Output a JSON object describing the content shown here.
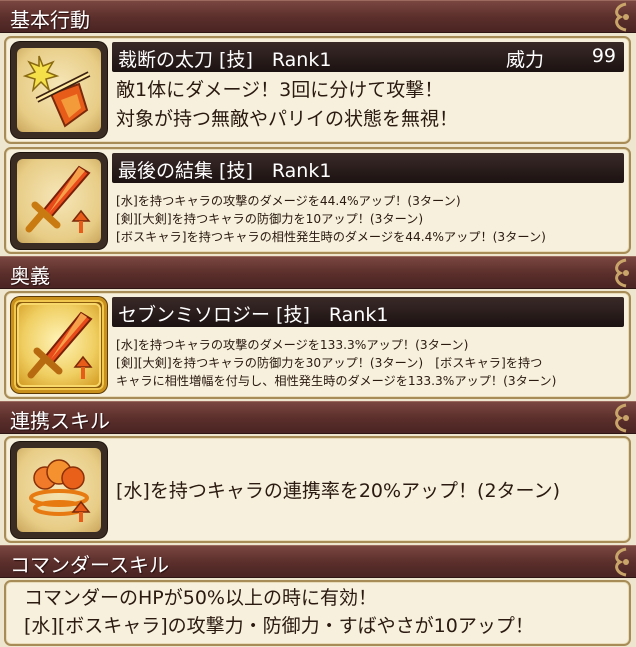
{
  "sections": {
    "basic": "基本行動",
    "ougi": "奥義",
    "renkei": "連携スキル",
    "commander": "コマンダースキル"
  },
  "skill1": {
    "name": "裁断の太刀 [技]　Rank1",
    "power_label": "威力",
    "power_value": "99",
    "lines": [
      "敵1体にダメージ！3回に分けて攻撃！",
      "対象が持つ無敵やパリイの状態を無視！"
    ],
    "icon": "slash-shield-icon"
  },
  "skill2": {
    "name": "最後の結集 [技]　Rank1",
    "lines": [
      "[水]を持つキャラの攻撃のダメージを44.4%アップ！(3ターン)",
      "[剣][大剣]を持つキャラの防御力を10アップ！(3ターン)",
      "[ボスキャラ]を持つキャラの相性発生時のダメージを44.4%アップ！(3ターン)"
    ],
    "icon": "sword-up-icon"
  },
  "skill3": {
    "name": "セブンミソロジー [技]　Rank1",
    "lines": [
      "[水]を持つキャラの攻撃のダメージを133.3%アップ！(3ターン)",
      "[剣][大剣]を持つキャラの防御力を30アップ！(3ターン)　[ボスキャラ]を持つ",
      "キャラに相性増幅を付与し、相性発生時のダメージを133.3%アップ！(3ターン)"
    ],
    "icon": "sword-up-gold-icon"
  },
  "renkei": {
    "text": "[水]を持つキャラの連携率を20%アップ！(2ターン)",
    "icon": "fire-rings-up-icon"
  },
  "commander": {
    "lines": [
      "コマンダーのHPが50%以上の時に有効！",
      "[水][ボスキャラ]の攻撃力・防御力・すばやさが10アップ！"
    ]
  }
}
